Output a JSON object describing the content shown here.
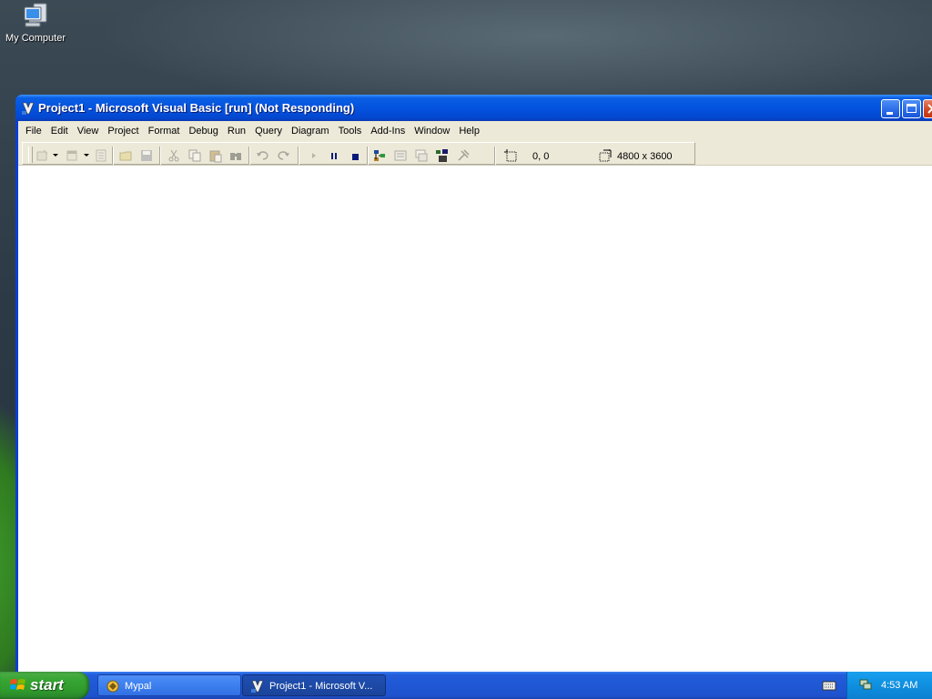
{
  "desktop": {
    "icons": [
      {
        "label": "My Computer",
        "icon": "my-computer-icon"
      }
    ]
  },
  "window": {
    "title": "Project1 - Microsoft Visual Basic [run] (Not Responding)",
    "menu": [
      "File",
      "Edit",
      "View",
      "Project",
      "Format",
      "Debug",
      "Run",
      "Query",
      "Diagram",
      "Tools",
      "Add-Ins",
      "Window",
      "Help"
    ],
    "toolbar": {
      "position_readout": "0, 0",
      "size_readout": "4800 x 3600"
    }
  },
  "taskbar": {
    "start_label": "start",
    "tasks": [
      {
        "label": "Mypal",
        "active": false
      },
      {
        "label": "Project1 - Microsoft V...",
        "active": true
      }
    ],
    "clock": "4:53 AM"
  },
  "colors": {
    "titlebar": "#0453de",
    "taskbar": "#245edb",
    "start": "#36a532",
    "chrome": "#ece9d8"
  }
}
